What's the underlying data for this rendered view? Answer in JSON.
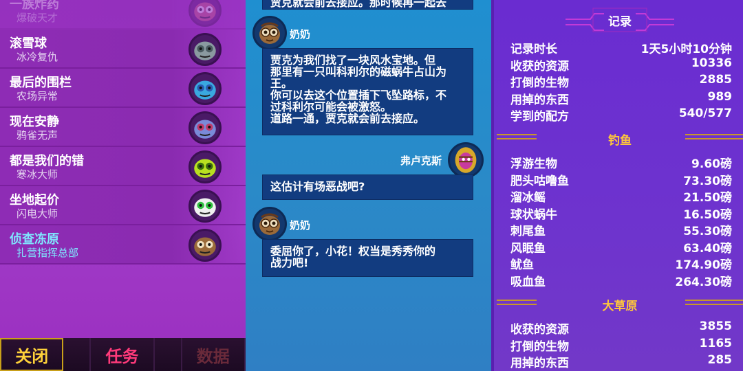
{
  "quests": [
    {
      "title": "一族炸药",
      "subtitle": "爆破天才",
      "faded": true,
      "icon": "creature-red-icon"
    },
    {
      "title": "滚雪球",
      "subtitle": "冰冷复仇",
      "icon": "creature-gray-icon"
    },
    {
      "title": "最后的围栏",
      "subtitle": "农场异常",
      "icon": "creature-blue-icon"
    },
    {
      "title": "现在安静",
      "subtitle": "鸦雀无声",
      "icon": "creature-purple-icon"
    },
    {
      "title": "都是我们的错",
      "subtitle": "寒冰大师",
      "icon": "creature-green-icon"
    },
    {
      "title": "坐地起价",
      "subtitle": "闪电大师",
      "icon": "creature-white-icon"
    },
    {
      "title": "侦查冻原",
      "subtitle": "扎营指挥总部",
      "active": true,
      "icon": "grandma-icon"
    }
  ],
  "tabs": {
    "close": "关闭",
    "mission": "任务",
    "data": "数据"
  },
  "chat": {
    "top_partial": "贾克就会前去接应。那时候再一起去",
    "msg1_speaker": "奶奶",
    "msg1_lines": [
      "贾克为我们找了一块风水宝地。但",
      "那里有一只叫科利尔的磁蜗牛占山为",
      "王。",
      "你可以去这个位置插下飞坠路标，不",
      "过科利尔可能会被激怒。",
      "道路一通，贾克就会前去接应。"
    ],
    "msg2_speaker": "弗卢克斯",
    "msg2_text": "这估计有场恶战吧?",
    "msg3_speaker": "奶奶",
    "msg3_lines": [
      "委屈你了，小花！权当是秀秀你的",
      "战力吧!"
    ]
  },
  "stats": {
    "title": "记录",
    "general": [
      {
        "k": "记录时长",
        "v": "1天5小时10分钟"
      },
      {
        "k": "收获的资源",
        "v": "10336"
      },
      {
        "k": "打倒的生物",
        "v": "2885"
      },
      {
        "k": "用掉的东西",
        "v": "989"
      },
      {
        "k": "学到的配方",
        "v": "540/577"
      }
    ],
    "fishing_title": "钓鱼",
    "fishing": [
      {
        "k": "浮游生物",
        "v": "9.60磅"
      },
      {
        "k": "肥头咕噜鱼",
        "v": "73.30磅"
      },
      {
        "k": "溜冰鳐",
        "v": "21.50磅"
      },
      {
        "k": "球状蜗牛",
        "v": "16.50磅"
      },
      {
        "k": "刺尾鱼",
        "v": "55.30磅"
      },
      {
        "k": "风眠鱼",
        "v": "63.40磅"
      },
      {
        "k": "鱿鱼",
        "v": "174.90磅"
      },
      {
        "k": "吸血鱼",
        "v": "264.30磅"
      }
    ],
    "grassland_title": "大草原",
    "grassland": [
      {
        "k": "收获的资源",
        "v": "3855"
      },
      {
        "k": "打倒的生物",
        "v": "1165"
      },
      {
        "k": "用掉的东西",
        "v": "285"
      }
    ]
  }
}
